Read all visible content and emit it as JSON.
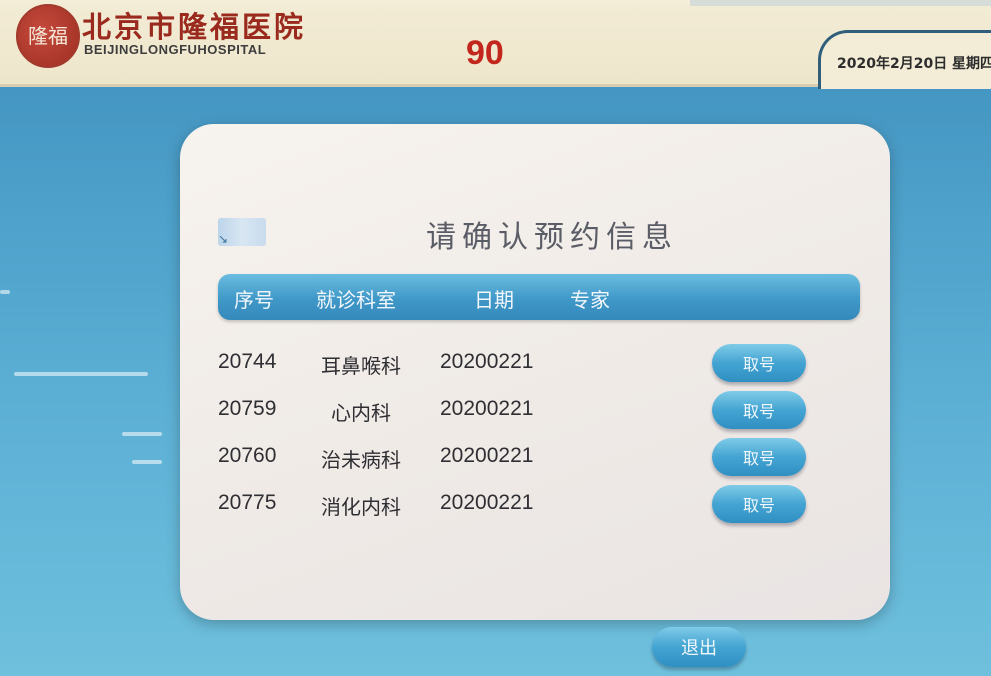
{
  "header": {
    "logo_text": "隆福",
    "hospital_name_cn": "北京市隆福医院",
    "hospital_name_en": "BEIJINGLONGFUHOSPITAL",
    "countdown": "90",
    "date": "2020年2月20日  星期四"
  },
  "dialog": {
    "title": "请确认预约信息",
    "columns": [
      "序号",
      "就诊科室",
      "日期",
      "专家"
    ],
    "rows": [
      {
        "number": "20744",
        "department": "耳鼻喉科",
        "date": "20200221",
        "expert": "",
        "action": "取号"
      },
      {
        "number": "20759",
        "department": "心内科",
        "date": "20200221",
        "expert": "",
        "action": "取号"
      },
      {
        "number": "20760",
        "department": "治未病科",
        "date": "20200221",
        "expert": "",
        "action": "取号"
      },
      {
        "number": "20775",
        "department": "消化内科",
        "date": "20200221",
        "expert": "",
        "action": "取号"
      }
    ]
  },
  "footer": {
    "exit_label": "退出"
  },
  "colors": {
    "accent_blue": "#3f98c8",
    "countdown_red": "#c2261c",
    "brand_red": "#9a2a1e"
  }
}
